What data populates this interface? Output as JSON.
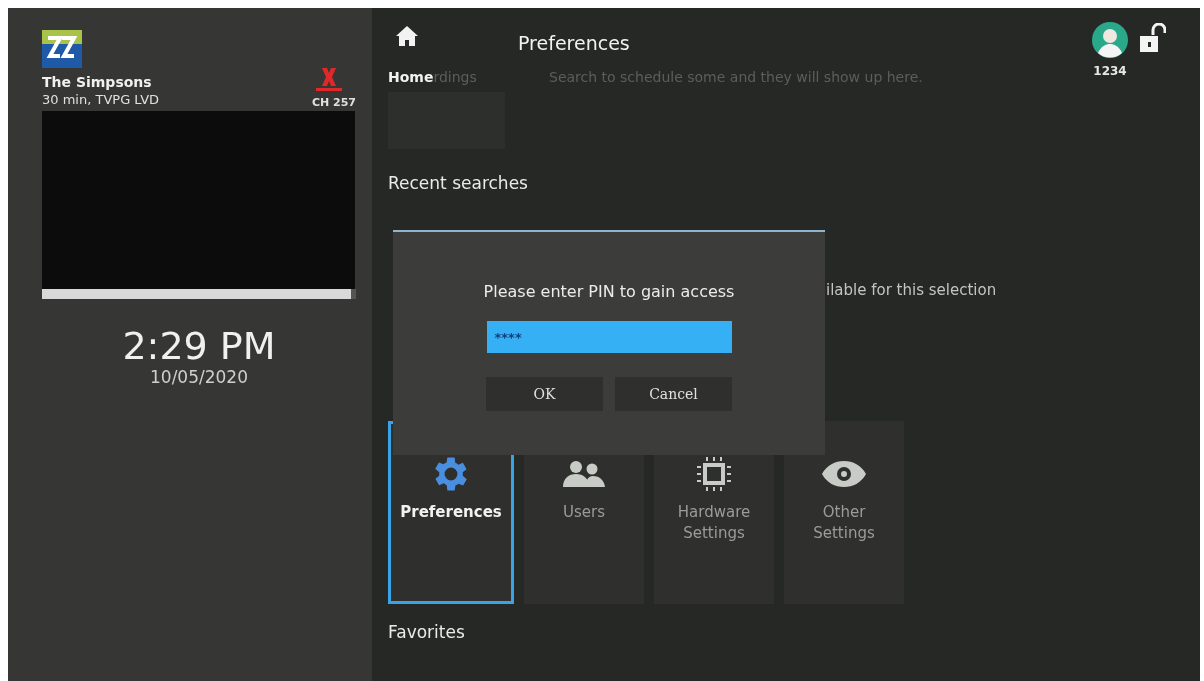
{
  "channel": {
    "title": "The Simpsons",
    "details": "30 min, TVPG LVD",
    "number": "CH 257"
  },
  "player": {
    "level": 0.985
  },
  "clock": {
    "time": "2:29 PM",
    "date": "10/05/2020"
  },
  "nav": {
    "home_label": "Home",
    "title": "Preferences"
  },
  "user": {
    "pin_label": "1234"
  },
  "background": {
    "section_fragment": "rdings",
    "hint": "Search to schedule some and they will show up here.",
    "recent_heading": "Recent searches",
    "notice_fragment": "ilable for this selection",
    "favorites_heading": "Favorites"
  },
  "tiles": [
    {
      "label": "Preferences",
      "kind": "gear",
      "selected": true
    },
    {
      "label": "Users",
      "kind": "users",
      "selected": false
    },
    {
      "label": "Hardware Settings",
      "kind": "chip",
      "selected": false
    },
    {
      "label": "Other Settings",
      "kind": "eye",
      "selected": false
    }
  ],
  "dialog": {
    "prompt": "Please enter PIN to gain access",
    "pin_value": "****",
    "buttons": [
      "OK",
      "Cancel"
    ]
  }
}
